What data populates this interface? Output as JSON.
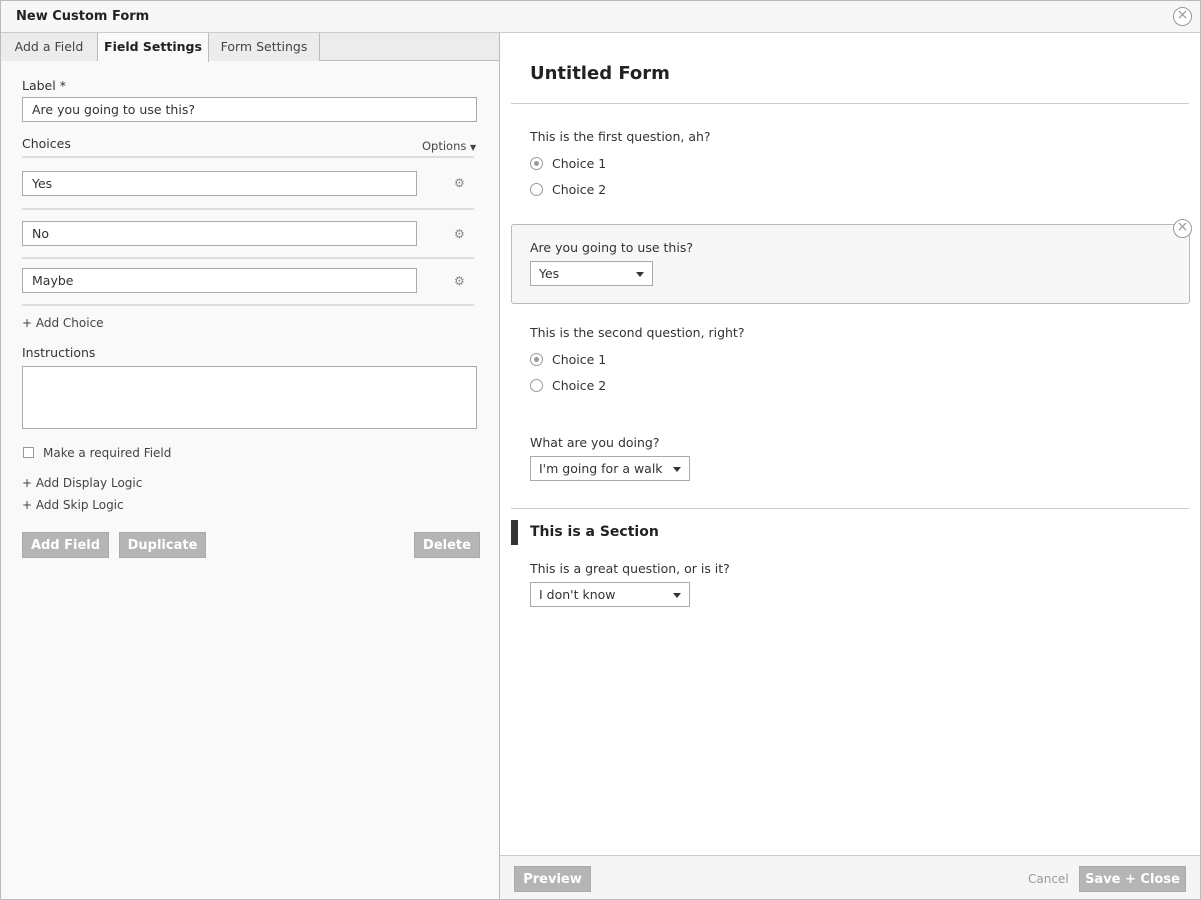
{
  "window": {
    "title": "New Custom Form"
  },
  "tabs": [
    {
      "label": "Add a Field"
    },
    {
      "label": "Field Settings"
    },
    {
      "label": "Form Settings"
    }
  ],
  "settings": {
    "label_title": "Label *",
    "label_value": "Are you going to use this?",
    "choices_title": "Choices",
    "options_label": "Options",
    "choices": [
      {
        "value": "Yes"
      },
      {
        "value": "No"
      },
      {
        "value": "Maybe"
      }
    ],
    "add_choice": "+ Add Choice",
    "instructions_title": "Instructions",
    "instructions_value": "",
    "required_label": "Make a required Field",
    "required_checked": false,
    "add_display_logic": "+ Add Display Logic",
    "add_skip_logic": "+ Add Skip Logic",
    "buttons": {
      "add_field": "Add Field",
      "duplicate": "Duplicate",
      "delete": "Delete"
    }
  },
  "preview": {
    "form_title": "Untitled Form",
    "q1": {
      "label": "This is the first question, ah?",
      "choices": [
        "Choice 1",
        "Choice 2"
      ],
      "selected_index": 0
    },
    "q2": {
      "label": "Are you going to use this?",
      "selected": "Yes"
    },
    "q3": {
      "label": "This is the second question, right?",
      "choices": [
        "Choice 1",
        "Choice 2"
      ],
      "selected_index": 0
    },
    "q4": {
      "label": "What are you doing?",
      "selected": "I'm going for a walk"
    },
    "section": {
      "title": "This is a Section"
    },
    "q5": {
      "label": "This is a great question, or is it?",
      "selected": "I don't know"
    }
  },
  "footer": {
    "preview": "Preview",
    "cancel": "Cancel",
    "save_close": "Save + Close"
  },
  "icons": {
    "close": "close-icon",
    "gear": "gear-icon",
    "caret": "caret-down-icon"
  },
  "colors": {
    "button_gray": "#b5b5b5",
    "section_bar": "#333333",
    "border": "#bbbbbb"
  }
}
